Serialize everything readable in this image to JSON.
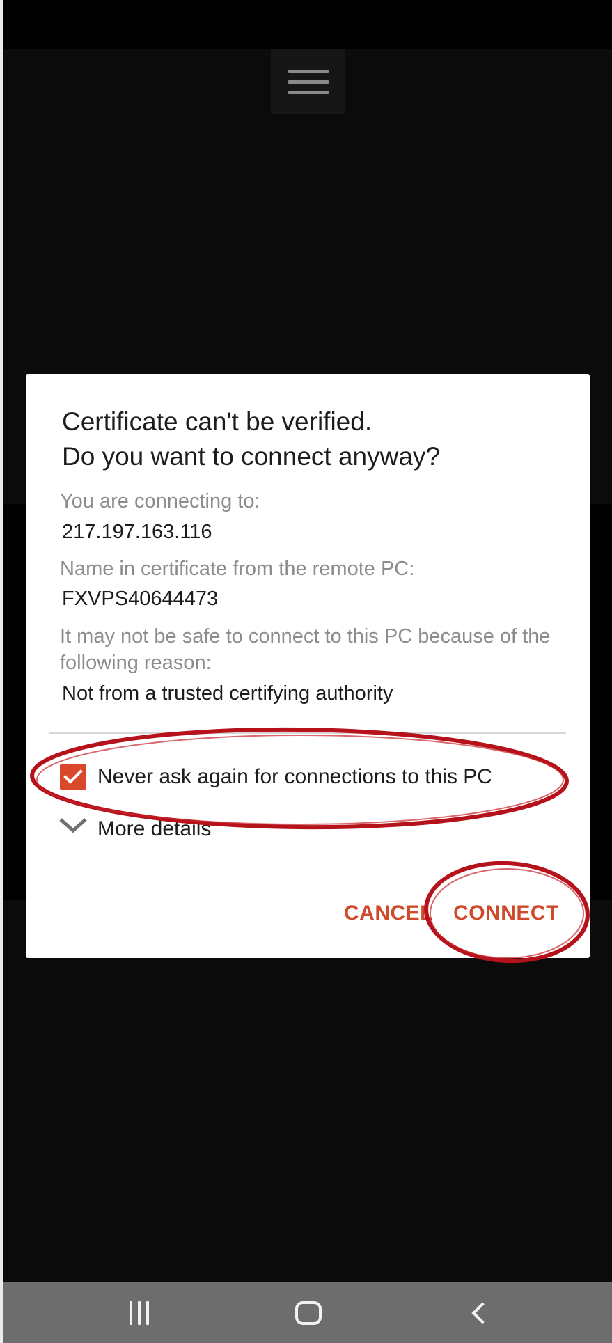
{
  "dialog": {
    "title_line1": "Certificate can't be verified.",
    "title_line2": "Do you want to connect anyway?",
    "connecting_label": "You are connecting to:",
    "connecting_value": "217.197.163.116",
    "cert_name_label": "Name in certificate from the remote PC:",
    "cert_name_value": "FXVPS40644473",
    "reason_label": "It may not be safe to connect to this PC because of the following reason:",
    "reason_value": "Not from a trusted certifying authority",
    "never_ask_label": "Never ask again for connections to this PC",
    "never_ask_checked": true,
    "more_details_label": "More details",
    "cancel_label": "CANCEL",
    "connect_label": "CONNECT"
  },
  "colors": {
    "accent": "#cf4a2a",
    "checkbox": "#d9482b",
    "annotation": "#b5121b"
  },
  "icons": {
    "menu": "hamburger-menu-icon",
    "checkbox": "checkmark-icon",
    "expand": "chevron-down-icon",
    "recent": "recent-apps-icon",
    "home": "home-icon",
    "back": "back-icon"
  }
}
